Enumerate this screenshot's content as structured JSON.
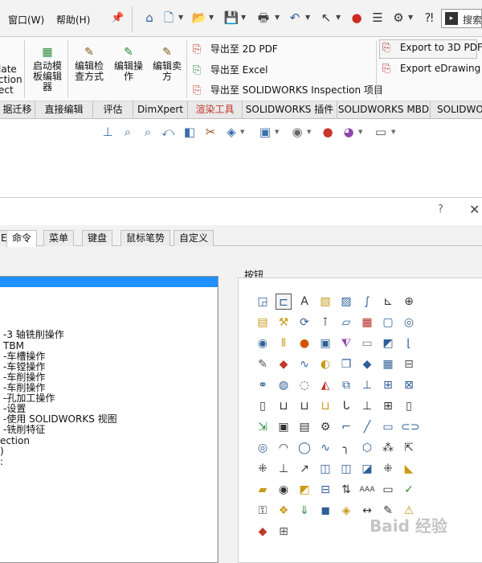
{
  "menubar": {
    "items": [
      "窗口(W)",
      "帮助(H)"
    ],
    "search_label": "搜索"
  },
  "ribbon": {
    "buttons": [
      {
        "label": "late\nction\nect"
      },
      {
        "label": "启动模\n板编辑\n器"
      },
      {
        "label": "编辑检\n查方式"
      },
      {
        "label": "编辑操\n作"
      },
      {
        "label": "编辑卖\n方"
      }
    ],
    "exports_left": [
      "导出至 2D PDF",
      "导出至 Excel",
      "导出至 SOLIDWORKS Inspection 项目"
    ],
    "exports_right": [
      "Export to 3D PDF",
      "Export eDrawing"
    ]
  },
  "tabs": [
    "据迁移",
    "直接编辑",
    "评估",
    "DimXpert",
    "渲染工具",
    "SOLIDWORKS 插件",
    "SOLIDWORKS MBD",
    "SOLIDWOR"
  ],
  "active_tab_index": 4,
  "dialog": {
    "help": "?",
    "close": "✕",
    "tabs": [
      "E",
      "命令",
      "菜单",
      "键盘",
      "鼠标笔势",
      "自定义"
    ],
    "active_tab_index": 1,
    "categories": [
      "",
      "-3 轴铣削操作",
      "TBM",
      "-车槽操作",
      "-车镗操作",
      "-车削操作",
      "-车削操作",
      "-孔加工操作",
      "-设置",
      "-使用 SOLIDWORKS 视图",
      "-铣削特征",
      "ection",
      ")",
      ":"
    ],
    "buttons_label": "按钮"
  },
  "watermark": "Baid 经验"
}
